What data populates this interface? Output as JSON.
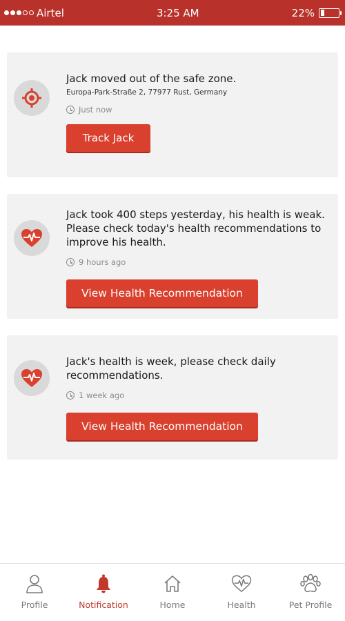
{
  "status_bar": {
    "carrier": "Airtel",
    "time": "3:25 AM",
    "battery": "22%",
    "battery_level": 0.22,
    "signal_bars_filled": 3,
    "signal_bars_total": 5
  },
  "notifications": [
    {
      "icon": "target-icon",
      "message": "Jack moved out of the safe zone.",
      "address": "Europa-Park-Straße 2, 77977 Rust, Germany",
      "time": "Just now",
      "button_label": "Track Jack"
    },
    {
      "icon": "heart-pulse-icon",
      "message": "Jack took 400 steps yesterday, his health is weak. Please check today's health recommendations to improve his health.",
      "time": "9 hours ago",
      "button_label": "View Health Recommendation"
    },
    {
      "icon": "heart-pulse-icon",
      "message": "Jack's health is week, please check daily recommendations.",
      "time": "1 week ago",
      "button_label": "View Health Recommendation"
    }
  ],
  "bottom_nav": {
    "items": [
      {
        "label": "Profile",
        "icon": "person-icon",
        "active": false
      },
      {
        "label": "Notification",
        "icon": "bell-icon",
        "active": true
      },
      {
        "label": "Home",
        "icon": "home-icon",
        "active": false
      },
      {
        "label": "Health",
        "icon": "heart-pulse-icon",
        "active": false
      },
      {
        "label": "Pet Profile",
        "icon": "paw-icon",
        "active": false
      }
    ]
  },
  "colors": {
    "brand_red": "#b8322b",
    "button_red": "#d9402d",
    "active_nav": "#c0392b",
    "card_bg": "#f2f2f2"
  }
}
